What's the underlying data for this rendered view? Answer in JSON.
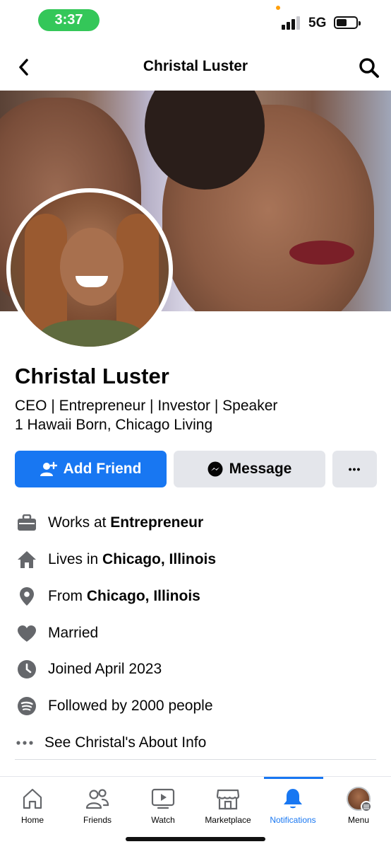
{
  "status_bar": {
    "time": "3:37",
    "network": "5G",
    "accent": "#34c759"
  },
  "header": {
    "title": "Christal Luster",
    "back_icon": "chevron-left-icon",
    "search_icon": "search-icon"
  },
  "profile": {
    "name": "Christal Luster",
    "bio_line1": "CEO | Entrepreneur | Investor | Speaker",
    "bio_line2": "1 Hawaii Born, Chicago Living"
  },
  "actions": {
    "add_friend": "Add Friend",
    "message": "Message",
    "more": "•••",
    "primary_color": "#1877f2"
  },
  "info": [
    {
      "icon": "briefcase-icon",
      "prefix": "Works at ",
      "bold": "Entrepreneur"
    },
    {
      "icon": "home-icon",
      "prefix": "Lives in ",
      "bold": "Chicago, Illinois"
    },
    {
      "icon": "location-pin-icon",
      "prefix": "From ",
      "bold": "Chicago, Illinois"
    },
    {
      "icon": "heart-icon",
      "prefix": "Married",
      "bold": ""
    },
    {
      "icon": "clock-icon",
      "prefix": "Joined April 2023",
      "bold": ""
    },
    {
      "icon": "rss-icon",
      "prefix": "Followed by 2000 people",
      "bold": ""
    },
    {
      "icon": "ellipsis-icon",
      "prefix": "See Christal's About Info",
      "bold": ""
    }
  ],
  "tabs": [
    {
      "label": "Home",
      "icon": "home-tab-icon"
    },
    {
      "label": "Friends",
      "icon": "friends-tab-icon"
    },
    {
      "label": "Watch",
      "icon": "watch-tab-icon"
    },
    {
      "label": "Marketplace",
      "icon": "marketplace-tab-icon"
    },
    {
      "label": "Notifications",
      "icon": "bell-tab-icon",
      "active": true
    },
    {
      "label": "Menu",
      "icon": "menu-avatar-icon"
    }
  ]
}
